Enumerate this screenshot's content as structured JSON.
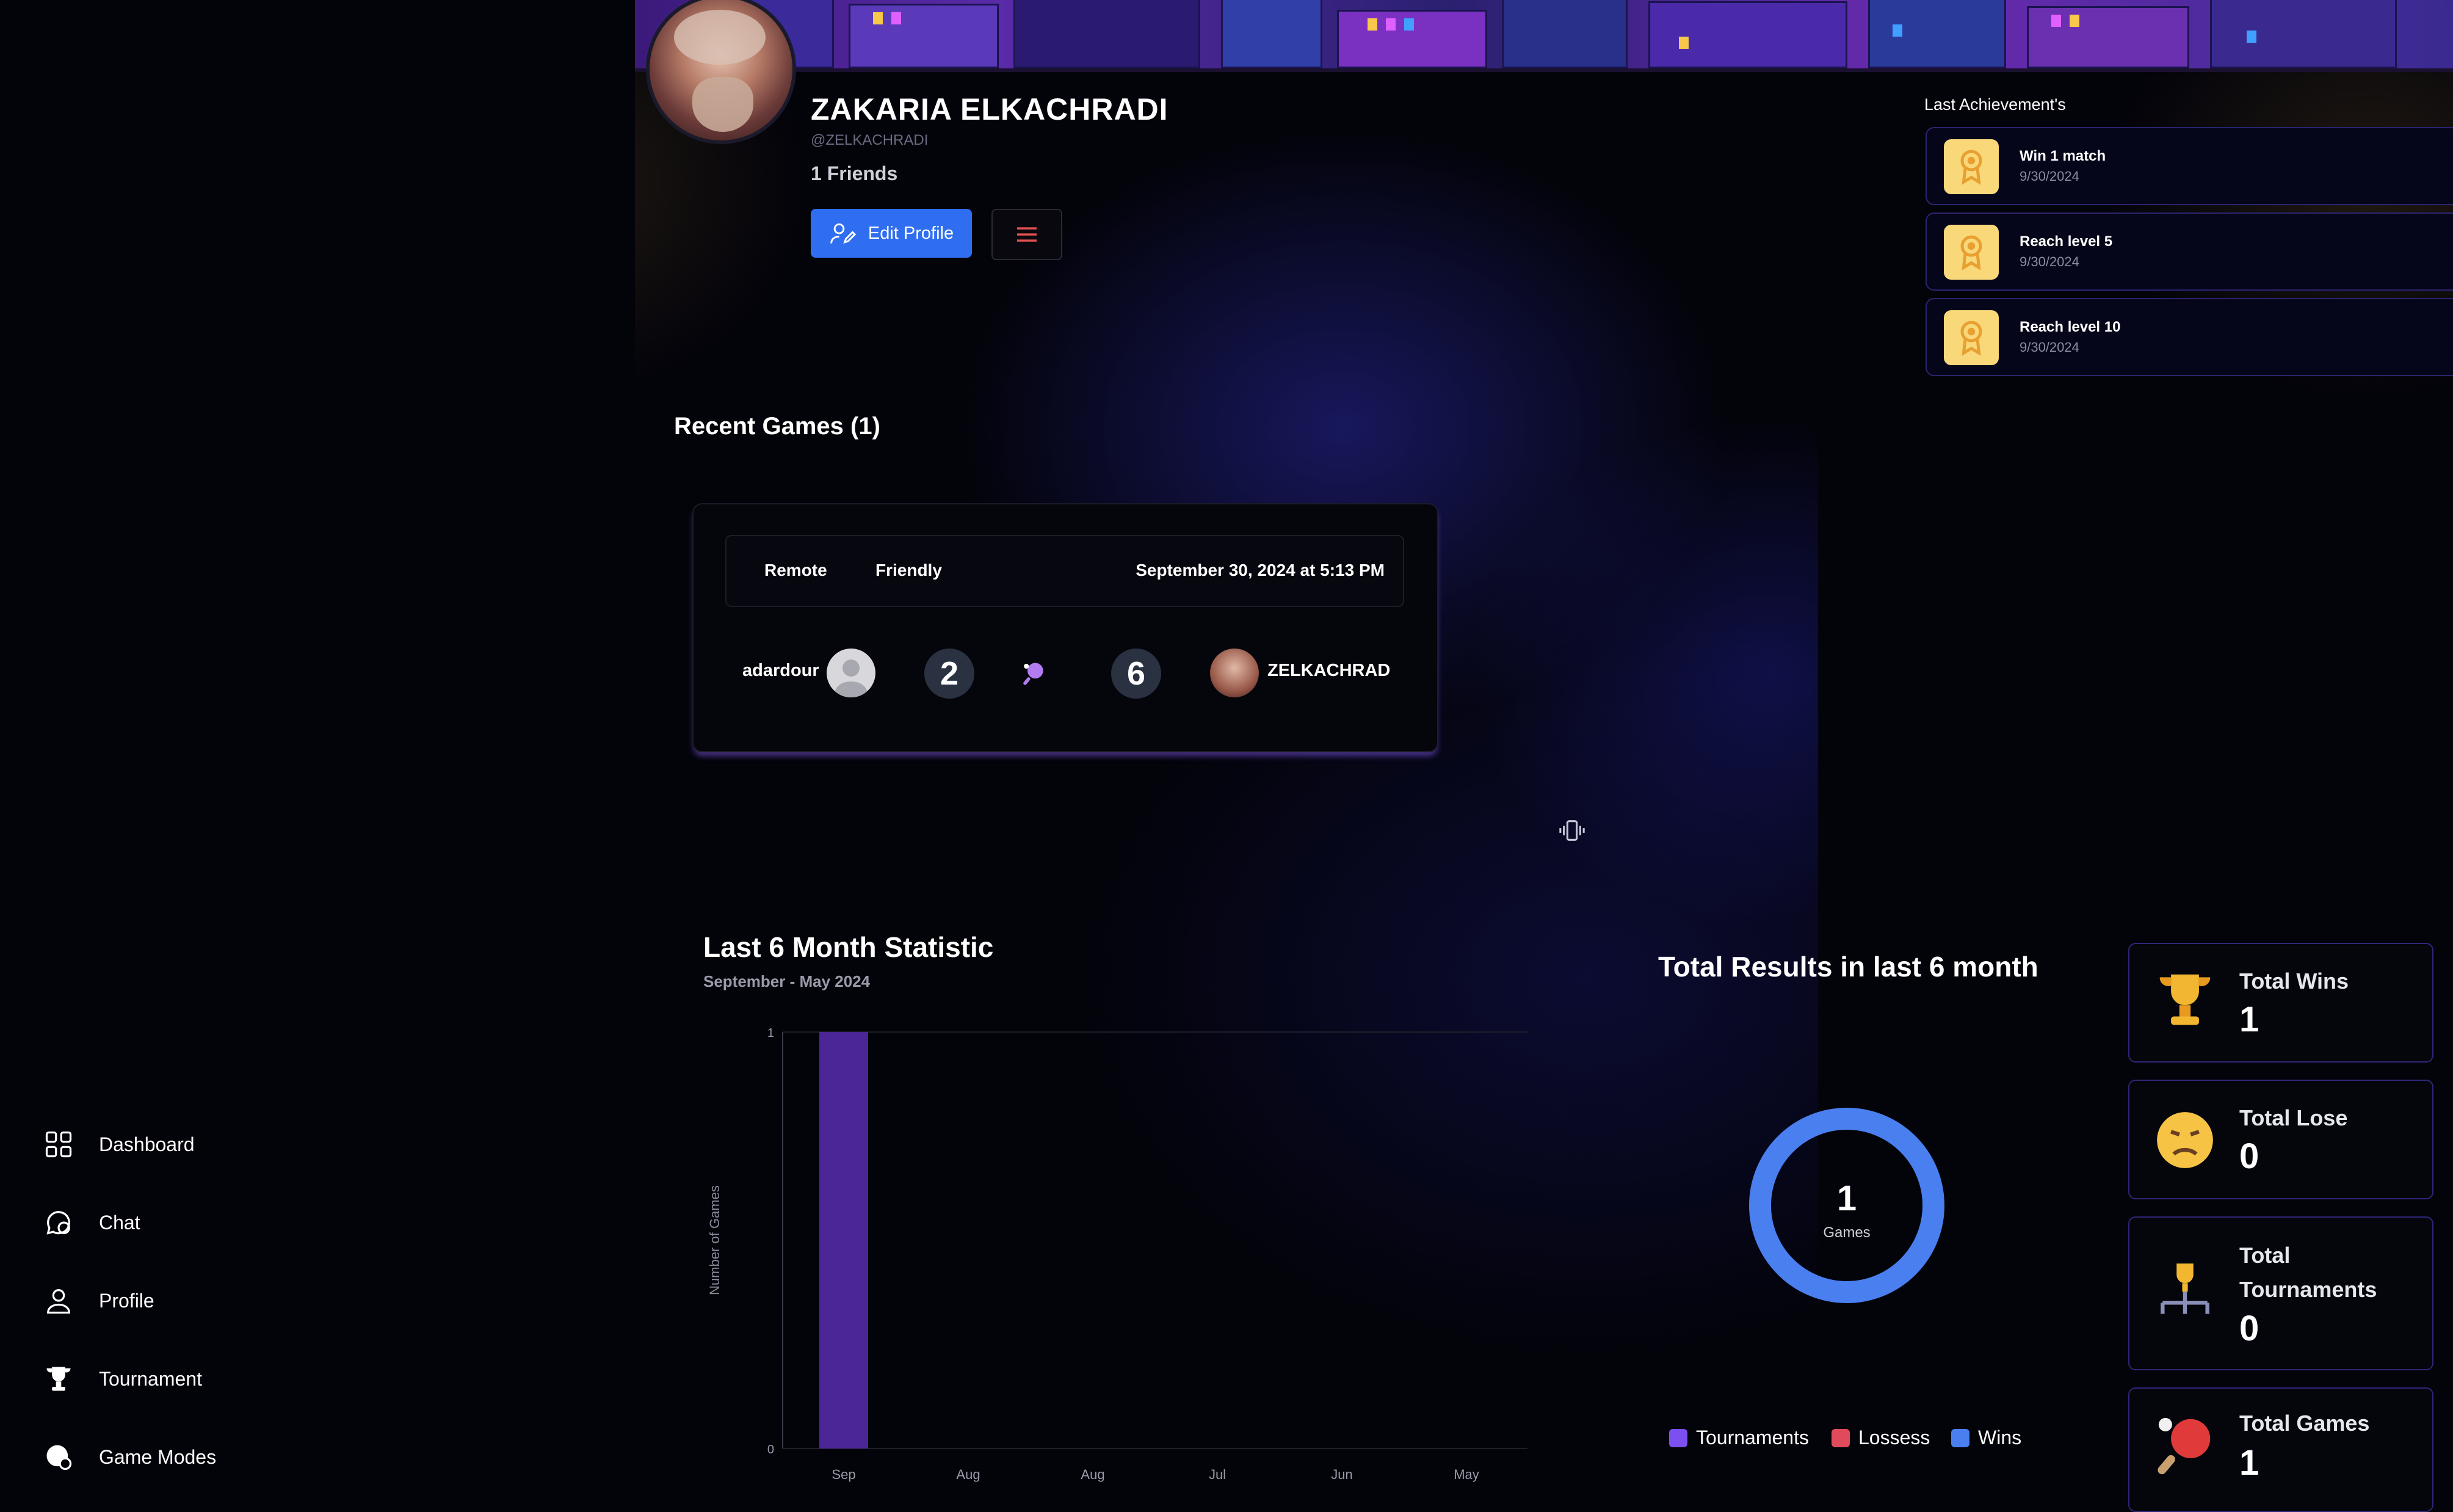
{
  "sidebar": {
    "items": [
      {
        "label": "Dashboard",
        "icon": "dashboard-icon"
      },
      {
        "label": "Chat",
        "icon": "chat-icon"
      },
      {
        "label": "Profile",
        "icon": "profile-icon"
      },
      {
        "label": "Tournament",
        "icon": "trophy-icon"
      },
      {
        "label": "Game Modes",
        "icon": "game-modes-icon"
      }
    ]
  },
  "profile": {
    "name": "ZAKARIA ELKACHRADI",
    "handle": "@ZELKACHRADI",
    "friends": "1 Friends",
    "edit_label": "Edit Profile"
  },
  "achievements": {
    "title": "Last Achievement's",
    "items": [
      {
        "name": "Win 1 match",
        "date": "9/30/2024"
      },
      {
        "name": "Reach level 5",
        "date": "9/30/2024"
      },
      {
        "name": "Reach level 10",
        "date": "9/30/2024"
      }
    ]
  },
  "recent_games": {
    "title": "Recent Games (1)",
    "game": {
      "mode": "Remote",
      "type": "Friendly",
      "date": "September 30, 2024 at 5:13 PM",
      "player1": "adardour",
      "score1": "2",
      "score2": "6",
      "player2": "ZELKACHRAD"
    }
  },
  "statistic": {
    "title": "Last 6 Month Statistic",
    "subtitle": "September - May 2024"
  },
  "chart_data": {
    "type": "bar",
    "categories": [
      "Sep",
      "Aug",
      "Aug",
      "Jul",
      "Jun",
      "May"
    ],
    "values": [
      1,
      0,
      0,
      0,
      0,
      0
    ],
    "ylabel": "Number of Games",
    "xlabel": "",
    "ylim": [
      0,
      1
    ],
    "yticks": [
      "0",
      "1"
    ],
    "bar_color": "#4a2696",
    "grid": false
  },
  "results": {
    "title": "Total Results in last 6 month",
    "total": "1",
    "total_label": "Games",
    "legend": [
      {
        "label": "Tournaments",
        "color": "#7b4ff0"
      },
      {
        "label": "Lossess",
        "color": "#e04a5a"
      },
      {
        "label": "Wins",
        "color": "#4a7ff0"
      }
    ]
  },
  "stats": {
    "wins_label": "Total Wins",
    "wins_value": "1",
    "lose_label": "Total Lose",
    "lose_value": "0",
    "tournaments_label": "Total Tournaments",
    "tournaments_value": "0",
    "games_label": "Total Games",
    "games_value": "1"
  },
  "colors": {
    "accent": "#2f6ef0",
    "donut": "#4a7ff0",
    "card_border": "#2c2878"
  }
}
